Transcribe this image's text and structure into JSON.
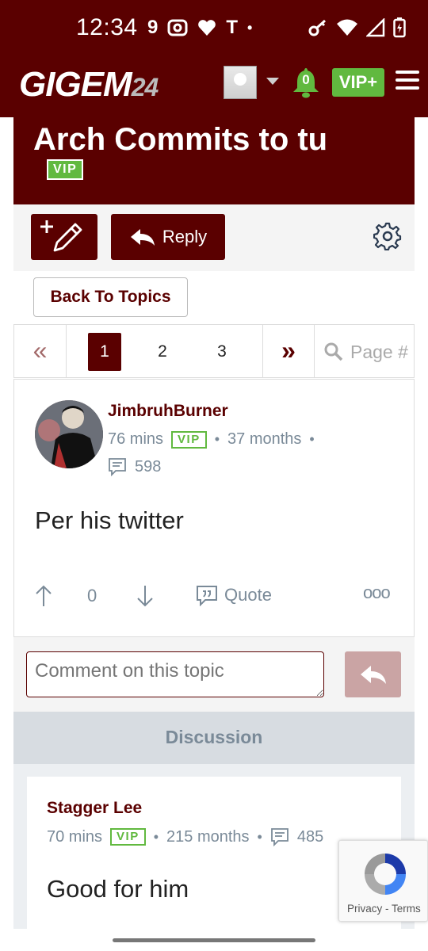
{
  "status_bar": {
    "time": "12:34",
    "left_icons": [
      "9",
      "instagram-icon",
      "heart-icon",
      "T",
      "•"
    ],
    "right_icons": [
      "key-icon",
      "wifi-icon",
      "signal-icon",
      "battery-charging-icon"
    ]
  },
  "header": {
    "logo_text": "GIGEM",
    "logo_num": "24",
    "notification_count": "0",
    "vip_plus_label": "VIP+"
  },
  "topic": {
    "title": "Arch Commits to tu",
    "vip_label": "VIP"
  },
  "toolbar": {
    "reply_label": "Reply"
  },
  "back_label": "Back To Topics",
  "pagination": {
    "first_symbol": "«",
    "pages": [
      "1",
      "2",
      "3"
    ],
    "active_page": "1",
    "last_symbol": "»",
    "search_placeholder": "Page #"
  },
  "post": {
    "author": "JimbruhBurner",
    "time": "76 mins",
    "vip_label": "VIP",
    "tenure": "37 months",
    "post_count": "598",
    "body": "Per his twitter",
    "votes": "0",
    "quote_label": "Quote",
    "more_label": "ooo"
  },
  "comment": {
    "placeholder": "Comment on this topic"
  },
  "discussion": {
    "header": "Discussion",
    "reply": {
      "author": "Stagger Lee",
      "time": "70 mins",
      "vip_label": "VIP",
      "tenure": "215 months",
      "post_count": "485",
      "body": "Good for him"
    }
  },
  "recaptcha": {
    "privacy": "Privacy",
    "separator": "-",
    "terms": "Terms"
  },
  "colors": {
    "brand": "#5a0000",
    "vip_green": "#61b93f",
    "meta_gray": "#7a8a98"
  }
}
